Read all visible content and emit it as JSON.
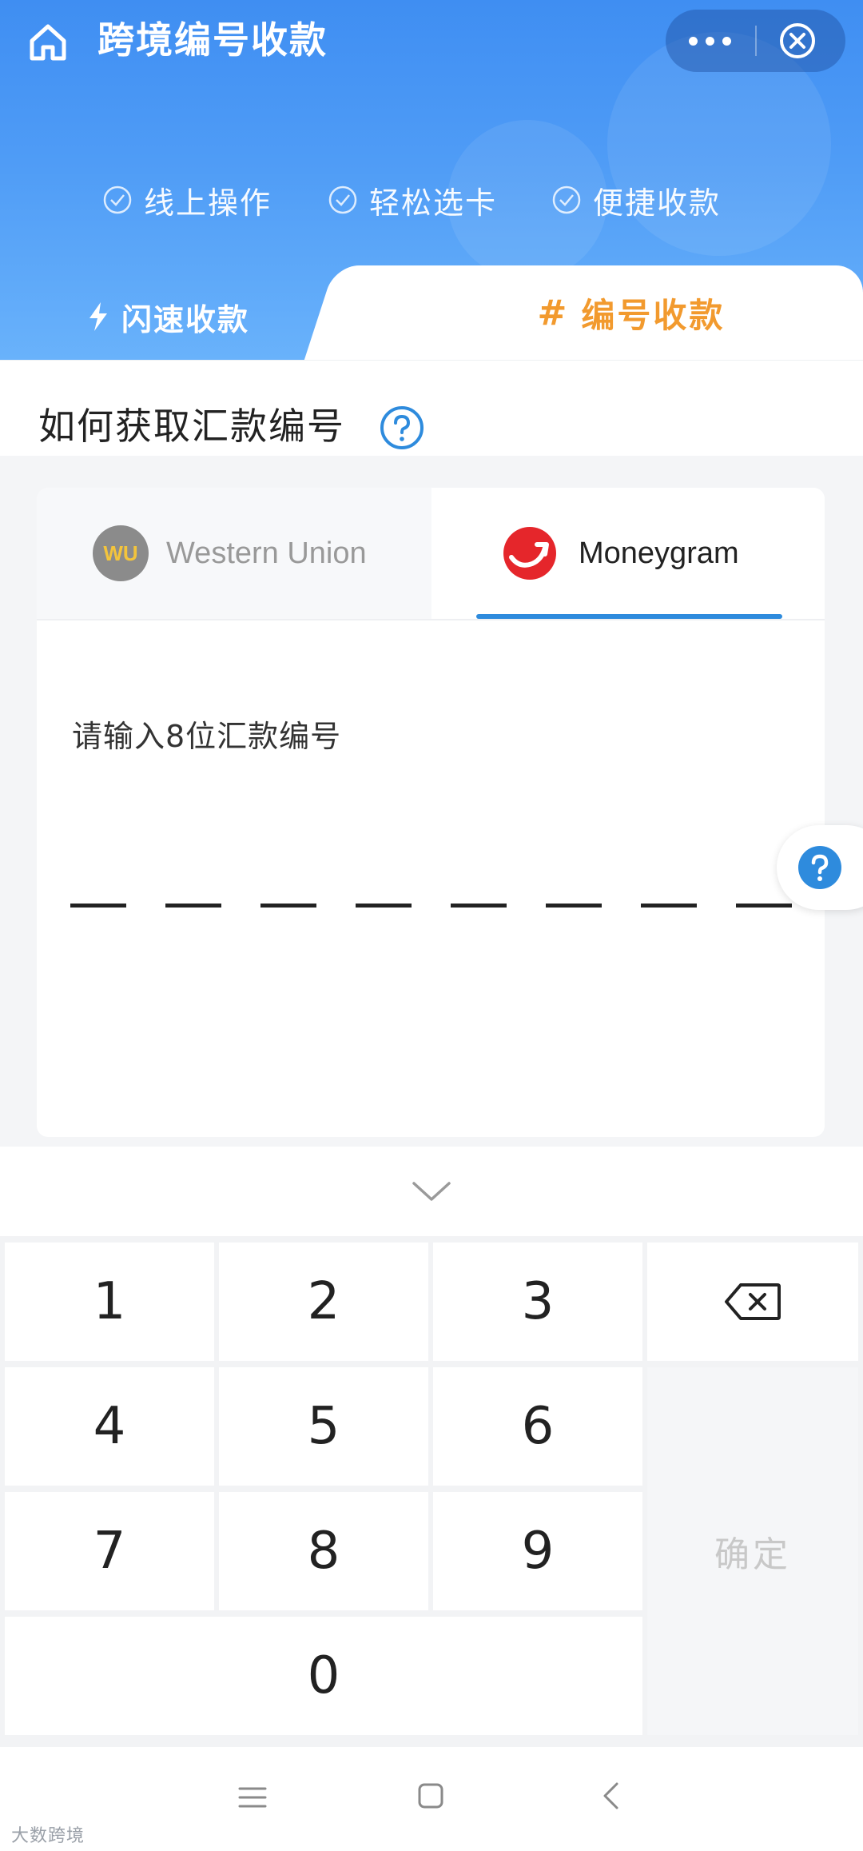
{
  "header": {
    "title": "跨境编号收款",
    "features": [
      "线上操作",
      "轻松选卡",
      "便捷收款"
    ]
  },
  "mode_tabs": {
    "flash": "闪速收款",
    "number": "编号收款"
  },
  "section": {
    "title": "如何获取汇款编号"
  },
  "card": {
    "tabs": {
      "western_union": "Western Union",
      "wu_logo_text": "WU",
      "moneygram": "Moneygram"
    },
    "input_prompt": "请输入8位汇款编号",
    "code_length": 8
  },
  "keypad": {
    "keys": [
      "1",
      "2",
      "3",
      "4",
      "5",
      "6",
      "7",
      "8",
      "9",
      "0"
    ],
    "confirm": "确定"
  },
  "watermark": "大数跨境",
  "colors": {
    "header_blue": "#4f9cf6",
    "accent_orange": "#f29a2e",
    "tab_underline": "#2e8bdd",
    "help_blue": "#2e8bdd"
  }
}
